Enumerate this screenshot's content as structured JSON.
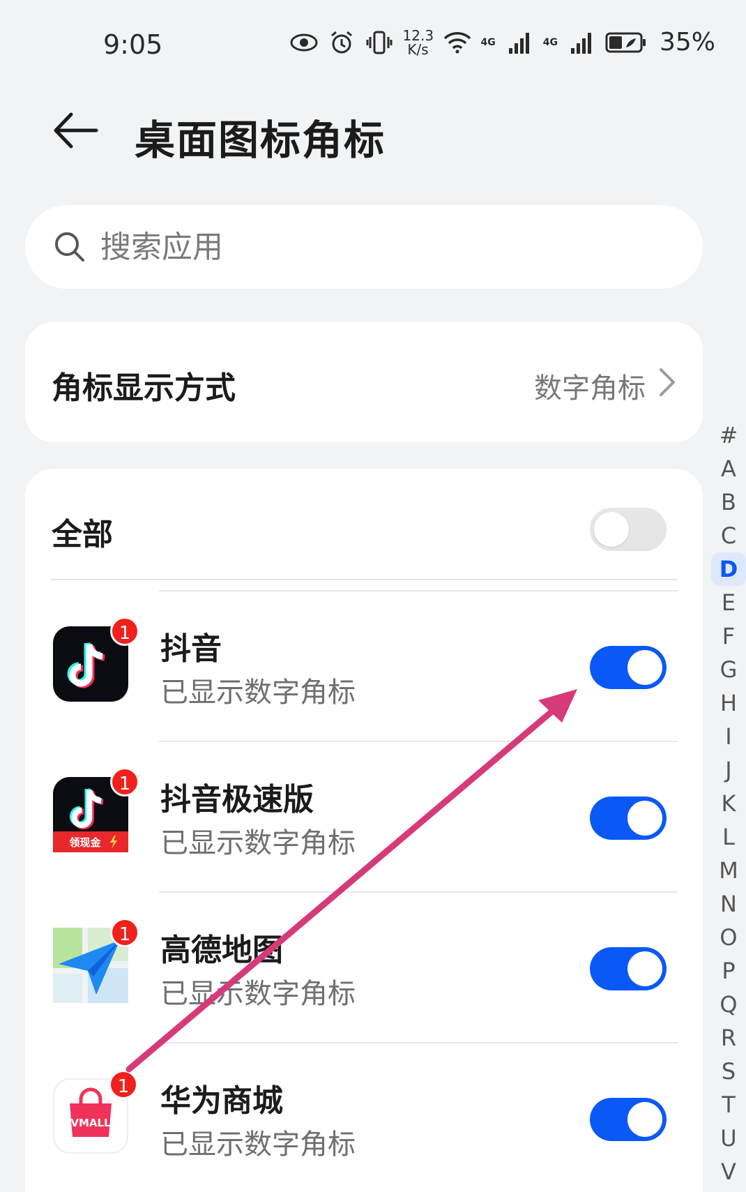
{
  "status_bar": {
    "time": "9:05",
    "speed_top": "12.3",
    "speed_bottom": "K/s",
    "net1": "4G",
    "net2": "4G",
    "battery": "35%"
  },
  "header": {
    "title": "桌面图标角标"
  },
  "search": {
    "placeholder": "搜索应用"
  },
  "badge_mode": {
    "label": "角标显示方式",
    "value": "数字角标"
  },
  "all": {
    "label": "全部",
    "enabled": false
  },
  "apps": [
    {
      "name": "抖音",
      "status": "已显示数字角标",
      "badge": "1",
      "enabled": true,
      "icon": "douyin-icon"
    },
    {
      "name": "抖音极速版",
      "status": "已显示数字角标",
      "badge": "1",
      "enabled": true,
      "icon": "douyin-lite-icon",
      "icon_caption": "领现金"
    },
    {
      "name": "高德地图",
      "status": "已显示数字角标",
      "badge": "1",
      "enabled": true,
      "icon": "amap-icon"
    },
    {
      "name": "华为商城",
      "status": "已显示数字角标",
      "badge": "1",
      "enabled": true,
      "icon": "vmall-icon",
      "icon_caption": "VMALL"
    }
  ],
  "index": [
    "#",
    "A",
    "B",
    "C",
    "D",
    "E",
    "F",
    "G",
    "H",
    "I",
    "J",
    "K",
    "L",
    "M",
    "N",
    "O",
    "P",
    "Q",
    "R",
    "S",
    "T",
    "U",
    "V"
  ],
  "index_active": "D",
  "colors": {
    "accent": "#0a59f7",
    "badge": "#f0201c",
    "annotation_arrow": "#d63a7a"
  }
}
